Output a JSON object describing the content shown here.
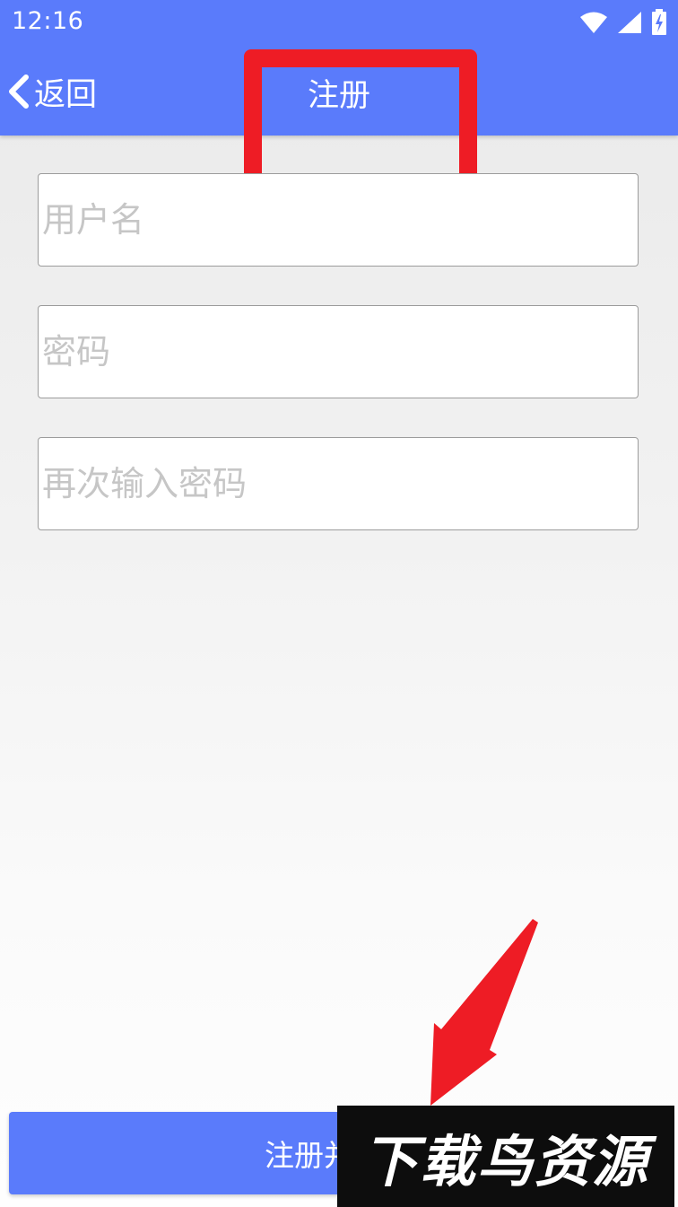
{
  "status_bar": {
    "time": "12:16",
    "icons": [
      "wifi-icon",
      "signal-icon",
      "battery-charging-icon"
    ]
  },
  "header": {
    "back_label": "返回",
    "title": "注册",
    "background_color": "#5a7bfb"
  },
  "form": {
    "username_placeholder": "用户名",
    "password_placeholder": "密码",
    "confirm_password_placeholder": "再次输入密码"
  },
  "submit": {
    "visible_label": "注册并"
  },
  "annotations": {
    "highlight_color": "#ee1c25",
    "arrow_color": "#ee1c25"
  },
  "watermark": {
    "text": "下载鸟资源"
  }
}
